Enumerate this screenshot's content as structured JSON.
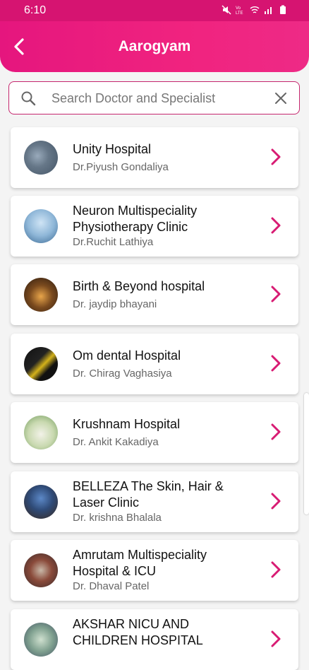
{
  "status": {
    "time": "6:10",
    "icons": [
      "mute-icon",
      "volte-icon",
      "wifi-icon",
      "signal-icon",
      "battery-icon"
    ]
  },
  "header": {
    "title": "Aarogyam",
    "back_icon": "back-arrow-icon"
  },
  "search": {
    "placeholder": "Search Doctor and Specialist",
    "value": ""
  },
  "colors": {
    "accent": "#e91e7d",
    "chevron": "#d81b73",
    "border": "#c5276e"
  },
  "hospitals": [
    {
      "name": "Unity Hospital",
      "doctor": "Dr.Piyush Gondaliya"
    },
    {
      "name": "Neuron Multispeciality Physiotherapy Clinic",
      "doctor": "Dr.Ruchit Lathiya"
    },
    {
      "name": "Birth & Beyond hospital",
      "doctor": "Dr. jaydip bhayani"
    },
    {
      "name": "Om dental Hospital",
      "doctor": "Dr. Chirag Vaghasiya"
    },
    {
      "name": "Krushnam Hospital",
      "doctor": "Dr. Ankit Kakadiya"
    },
    {
      "name": "BELLEZA The Skin, Hair & Laser Clinic",
      "doctor": "Dr. krishna Bhalala"
    },
    {
      "name": "Amrutam Multispeciality Hospital & ICU",
      "doctor": "Dr. Dhaval Patel"
    },
    {
      "name": "AKSHAR NICU AND CHILDREN HOSPITAL",
      "doctor": ""
    }
  ]
}
